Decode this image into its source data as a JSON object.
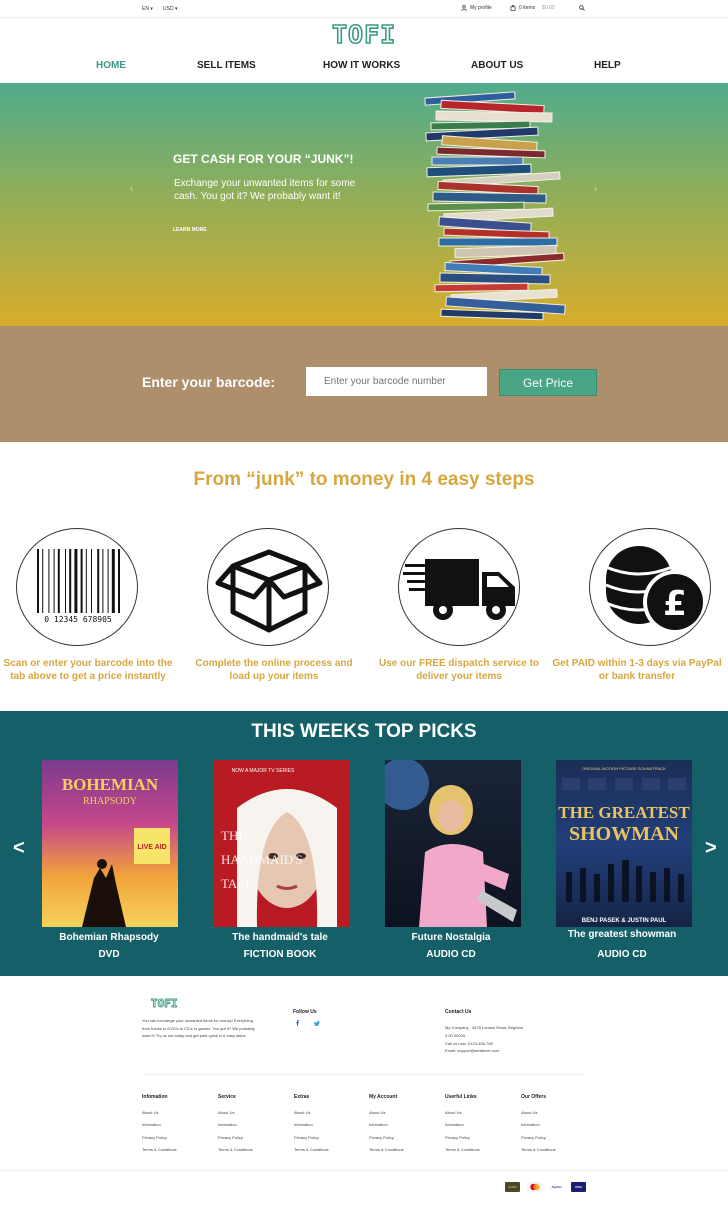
{
  "topbar": {
    "language": "EN",
    "currency": "USD",
    "profile": "My profile",
    "cart_items": "0 items",
    "cart_total": "$0.00"
  },
  "logo": "TOFI",
  "nav": [
    "HOME",
    "SELL ITEMS",
    "HOW IT WORKS",
    "ABOUT US",
    "HELP"
  ],
  "hero": {
    "title": "GET CASH FOR YOUR “JUNK”!",
    "subtitle": "Exchange your unwanted items for some cash. You got it? We probably want it!",
    "link": "LEARN MORE",
    "prev": "‹",
    "next": "›"
  },
  "barcode": {
    "label": "Enter your barcode:",
    "placeholder": "Enter your barcode number",
    "button": "Get Price"
  },
  "steps": {
    "title": "From “junk”  to money in 4 easy steps",
    "barcode_digits": "0 12345 678905",
    "items": [
      "Scan or enter your barcode into the tab above to get a price instantly",
      "Complete the online process and load up your items",
      "Use our FREE dispatch service to deliver your items",
      "Get PAID within 1-3 days via PayPal or bank transfer"
    ]
  },
  "picks": {
    "title": "THIS WEEKS TOP PICKS",
    "prev": "<",
    "next": ">",
    "items": [
      {
        "name": "Bohemian Rhapsody",
        "type": "DVD",
        "cover_title": "BOHEMIAN",
        "cover_sub": "RHAPSODY",
        "cover_badge": "LIVE AID"
      },
      {
        "name": "The handmaid's tale",
        "type": "FICTION BOOK",
        "cover_title": "THE HANDMAID'S TALE",
        "cover_sub": "NOW A MAJOR TV SERIES"
      },
      {
        "name": "Future Nostalgia",
        "type": "AUDIO CD"
      },
      {
        "name": "The greatest showman",
        "type": "AUDIO CD",
        "cover_title": "THE GREATEST SHOWMAN",
        "cover_sub": "ORIGINAL MOTION PICTURE SOUNDTRACK",
        "cover_credits": "BENJ PASEK & JUSTIN PAUL"
      }
    ]
  },
  "footer": {
    "logo": "TOFI",
    "description": "You can exchange your unwanted items for money! Everything from books to DVD's to CD's to games. You got it? We probably want it! Try us out today and get paid quick in 6 easy steps",
    "follow_title": "Follow Us",
    "contact_title": "Contact Us",
    "contact_lines": [
      "My Company , 4578 London Road, Brighton",
      "0.00.00009",
      "Call us now: 0123-456-789",
      "Email: support@whatever.com"
    ],
    "columns": [
      {
        "title": "Infomation",
        "links": [
          "About Us",
          "Infomation",
          "Privacy Policy",
          "Terms & Conditions"
        ]
      },
      {
        "title": "Service",
        "links": [
          "About Us",
          "Infomation",
          "Privacy Policy",
          "Terms & Conditions"
        ]
      },
      {
        "title": "Extras",
        "links": [
          "About Us",
          "Infomation",
          "Privacy Policy",
          "Terms & Conditions"
        ]
      },
      {
        "title": "My Account",
        "links": [
          "About Us",
          "Infomation",
          "Privacy Policy",
          "Terms & Conditions"
        ]
      },
      {
        "title": "Userful Links",
        "links": [
          "About Us",
          "Infomation",
          "Privacy Policy",
          "Terms & Conditions"
        ]
      },
      {
        "title": "Our Offers",
        "links": [
          "About Us",
          "Infomation",
          "Privacy Policy",
          "Terms & Conditions"
        ]
      }
    ],
    "payments": [
      "AMEX",
      "MC",
      "PayPal",
      "VISA"
    ]
  }
}
